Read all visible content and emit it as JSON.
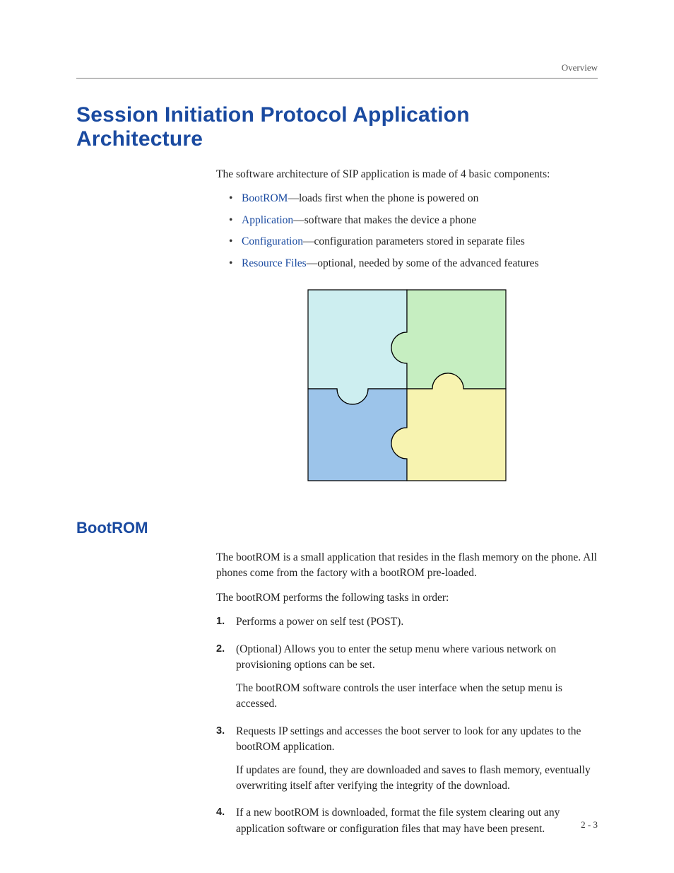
{
  "running_head": "Overview",
  "title": "Session Initiation Protocol Application Architecture",
  "intro": "The software architecture of SIP application is made of 4 basic components:",
  "components": [
    {
      "link": "BootROM",
      "desc": "—loads first when the phone is powered on"
    },
    {
      "link": "Application",
      "desc": "—software that makes the device a phone"
    },
    {
      "link": "Configuration",
      "desc": "—configuration parameters stored in separate files"
    },
    {
      "link": "Resource Files",
      "desc": "—optional, needed by some of the advanced features"
    }
  ],
  "section_bootrom": {
    "heading": "BootROM",
    "p1": "The bootROM is a small application that resides in the flash memory on the phone. All phones come from the factory with a bootROM pre-loaded.",
    "p2": "The bootROM performs the following tasks in order:",
    "steps": [
      {
        "main": "Performs a power on self test (POST)."
      },
      {
        "main": "(Optional) Allows you to enter the setup menu where various network on provisioning options can be set.",
        "sub": "The bootROM software controls the user interface when the setup menu is accessed."
      },
      {
        "main": "Requests IP settings and accesses the boot server to look for any updates to the bootROM application.",
        "sub": "If updates are found, they are downloaded and saves to flash memory, eventually overwriting itself after verifying the integrity of the download."
      },
      {
        "main": "If a new bootROM is downloaded, format the file system clearing out any application software or configuration files that may have been present."
      }
    ]
  },
  "page_number": "2 - 3"
}
